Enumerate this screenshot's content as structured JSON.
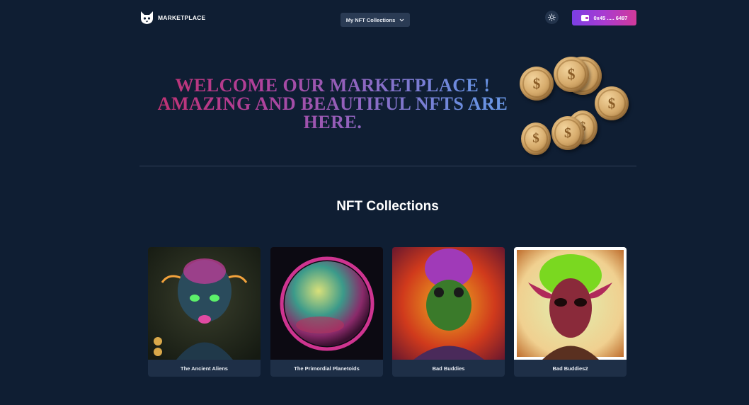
{
  "header": {
    "brand": "MARKETPLACE",
    "collections_button": "My NFT Collections",
    "wallet_address": "0x45 ..... 6497"
  },
  "hero": {
    "lines": [
      "WELCOME OUR MARKETPLACE !",
      "AMAZING AND BEAUTIFUL NFTS ARE",
      "HERE."
    ]
  },
  "collections": {
    "title": "NFT Collections",
    "items": [
      {
        "name": "The Ancient Aliens"
      },
      {
        "name": "The Primordial Planetoids"
      },
      {
        "name": "Bad Buddies"
      },
      {
        "name": "Bad Buddies2"
      }
    ]
  },
  "icons": {
    "logo": "cat-head-icon",
    "dropdown": "chevron-down-icon",
    "theme": "sun-icon",
    "wallet": "wallet-icon",
    "coin": "coin-icon"
  },
  "colors": {
    "background": "#0f1e33",
    "wallet_gradient_start": "#7b3fe4",
    "wallet_gradient_end": "#d23a9a",
    "card_footer": "#1e2f47"
  }
}
